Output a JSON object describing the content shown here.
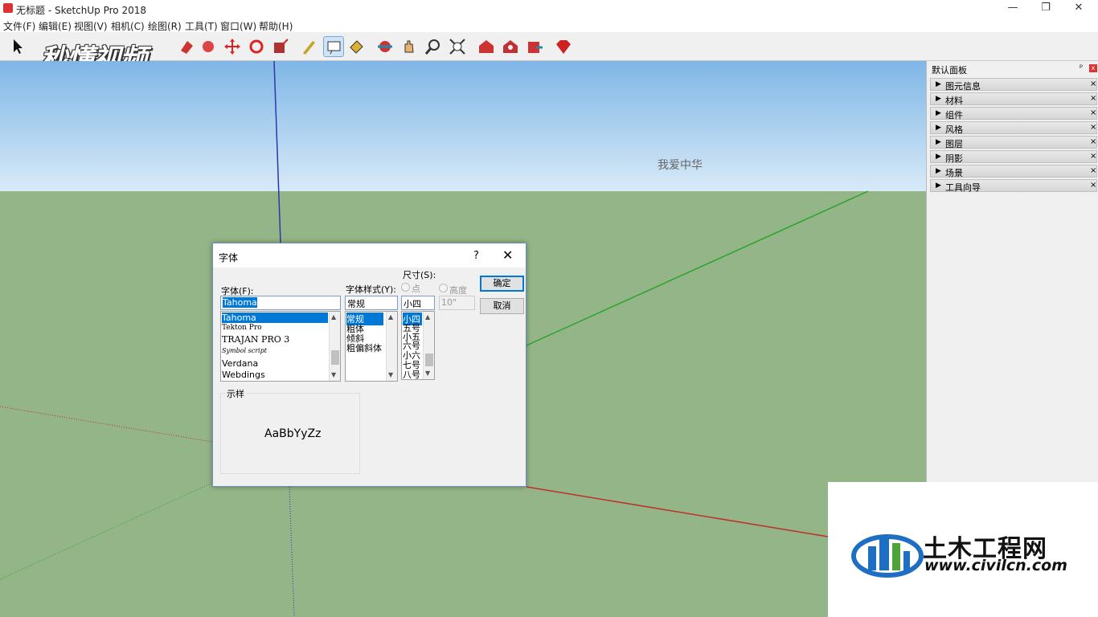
{
  "window": {
    "title": "无标题 - SketchUp Pro 2018",
    "min": "—",
    "restore": "❐",
    "close": "✕"
  },
  "menu": [
    "文件(F)",
    "编辑(E)",
    "视图(V)",
    "相机(C)",
    "绘图(R)",
    "工具(T)",
    "窗口(W)",
    "帮助(H)"
  ],
  "watermark": {
    "brand": "秒懂视频"
  },
  "scene": {
    "text3d": "我爱中华"
  },
  "tray": {
    "title": "默认面板",
    "pin": "ᵖ",
    "close": "x",
    "items": [
      "图元信息",
      "材料",
      "组件",
      "风格",
      "图层",
      "阴影",
      "场景",
      "工具向导"
    ]
  },
  "dialog": {
    "title": "字体",
    "help": "?",
    "close": "✕",
    "font_label": "字体(F):",
    "font_value": "Tahoma",
    "fonts": [
      "Tahoma",
      "Tekton Pro",
      "TRAJAN PRO 3",
      "Symbol script",
      "Verdana",
      "Webdings"
    ],
    "style_label": "字体样式(Y):",
    "style_value": "常规",
    "styles": [
      "常规",
      "粗体",
      "倾斜",
      "粗偏斜体"
    ],
    "size_label": "尺寸(S):",
    "radio_points": "点",
    "radio_height": "高度",
    "size_value": "小四",
    "height_value": "10\"",
    "sizes": [
      "小四",
      "五号",
      "小五",
      "六号",
      "小六",
      "七号",
      "八号"
    ],
    "ok": "确定",
    "cancel": "取消",
    "sample_label": "示样",
    "sample_text": "AaBbYyZz"
  },
  "civil_logo": {
    "name": "土木工程网",
    "url": "www.civilcn.com"
  },
  "colors": {
    "sky": "#7fb6e6",
    "ground": "#93b587",
    "axis_blue": "#2b3aa8",
    "axis_green": "#29a529",
    "axis_red": "#c0302a"
  }
}
